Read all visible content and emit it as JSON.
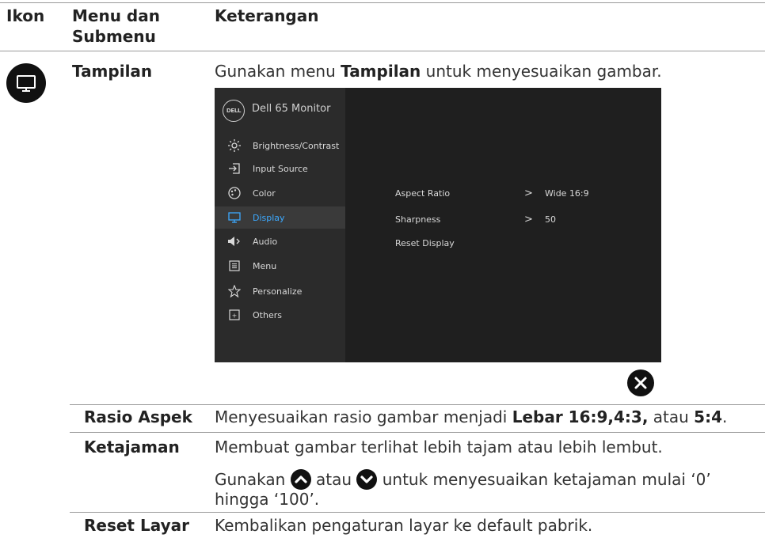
{
  "header": {
    "col_icon": "Ikon",
    "col_menu_line1": "Menu dan",
    "col_menu_line2": "Submenu",
    "col_desc": "Keterangan"
  },
  "tampilan": {
    "title": "Tampilan",
    "desc_pre": "Gunakan menu ",
    "desc_bold": "Tampilan",
    "desc_post": " untuk menyesuaikan gambar."
  },
  "osd": {
    "brand": "Dell 65 Monitor",
    "logo_text": "DELL",
    "menu": [
      {
        "label": "Brightness/Contrast",
        "icon": "brightness-icon"
      },
      {
        "label": "Input Source",
        "icon": "input-source-icon"
      },
      {
        "label": "Color",
        "icon": "color-palette-icon"
      },
      {
        "label": "Display",
        "icon": "display-icon",
        "active": true
      },
      {
        "label": "Audio",
        "icon": "speaker-icon"
      },
      {
        "label": "Menu",
        "icon": "menu-list-icon"
      },
      {
        "label": "Personalize",
        "icon": "star-icon"
      },
      {
        "label": "Others",
        "icon": "others-icon"
      }
    ],
    "settings": [
      {
        "label": "Aspect Ratio",
        "arrow": ">",
        "value": "Wide 16:9"
      },
      {
        "label": "Sharpness",
        "arrow": ">",
        "value": "50"
      },
      {
        "label": "Reset Display",
        "arrow": "",
        "value": ""
      }
    ],
    "accent_color": "#3ca9ff"
  },
  "rows": {
    "aspect": {
      "name": "Rasio Aspek",
      "desc_pre": "Menyesuaikan rasio gambar menjadi ",
      "bold1": "Lebar 16:9,4:3,",
      "mid": " atau ",
      "bold2": "5:4",
      "end": "."
    },
    "sharpness": {
      "name": "Ketajaman",
      "desc1": "Membuat gambar terlihat lebih tajam atau lebih lembut.",
      "desc2_a": "Gunakan ",
      "desc2_b": " atau ",
      "desc2_c": " untuk menyesuaikan ketajaman mulai ‘0’",
      "desc3": "hingga ‘100’."
    },
    "reset": {
      "name": "Reset Layar",
      "desc": "Kembalikan pengaturan layar ke default pabrik."
    }
  }
}
